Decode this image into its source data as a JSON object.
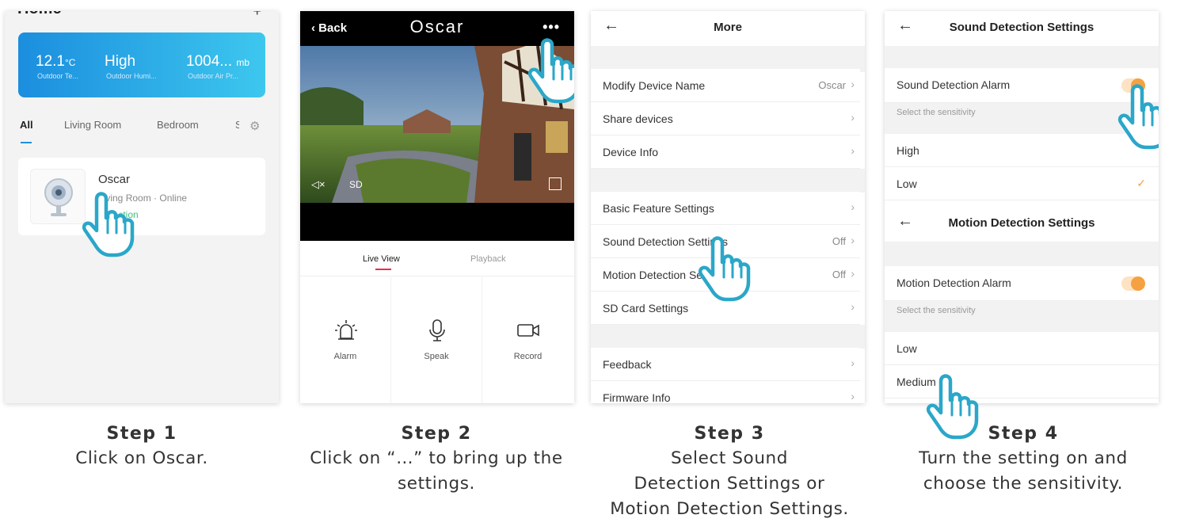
{
  "step1": {
    "home_title": "Home",
    "plus": "+",
    "weather": [
      {
        "value": "12.1",
        "unit": "°C",
        "label": "Outdoor Te..."
      },
      {
        "value": "High",
        "unit": "",
        "label": "Outdoor Humi..."
      },
      {
        "value": "1004...",
        "unit": "mb",
        "label": "Outdoor Air Pr..."
      }
    ],
    "tabs": [
      "All",
      "Living Room",
      "Bedroom",
      "S"
    ],
    "device": {
      "name": "Oscar",
      "room": "Living Room",
      "status": "Online",
      "tag": "Detection"
    },
    "caption_step": "Step 1",
    "caption_lines": [
      "Click on Oscar."
    ]
  },
  "step2": {
    "back_label": "Back",
    "title": "Oscar",
    "dots": "•••",
    "sd_label": "SD",
    "tab_live": "Live View",
    "tab_playback": "Playback",
    "actions": [
      "Alarm",
      "Speak",
      "Record"
    ],
    "caption_step": "Step 2",
    "caption_lines": [
      "Click on “…” to bring up the",
      "settings."
    ]
  },
  "step3": {
    "title": "More",
    "rows": [
      {
        "label": "Modify Device Name",
        "value": "Oscar"
      },
      {
        "label": "Share devices",
        "value": ""
      },
      {
        "label": "Device Info",
        "value": ""
      },
      {
        "label": "Basic Feature Settings",
        "value": ""
      },
      {
        "label": "Sound Detection Settings",
        "value": "Off"
      },
      {
        "label": "Motion Detection Settings",
        "value": "Off"
      },
      {
        "label": "SD Card Settings",
        "value": ""
      },
      {
        "label": "Feedback",
        "value": ""
      },
      {
        "label": "Firmware Info",
        "value": ""
      }
    ],
    "caption_step": "Step 3",
    "caption_lines": [
      "Select Sound",
      "Detection Settings or",
      "Motion Detection Settings."
    ]
  },
  "step4": {
    "sound_title": "Sound Detection Settings",
    "sound_alarm": "Sound Detection Alarm",
    "sensitivity": "Select the sensitivity",
    "sound_options": [
      "High",
      "Low"
    ],
    "motion_title": "Motion Detection Settings",
    "motion_alarm": "Motion Detection Alarm",
    "motion_options": [
      "Low",
      "Medium"
    ],
    "caption_step": "Step 4",
    "caption_lines": [
      "Turn the setting on and",
      "choose the sensitivity."
    ]
  },
  "colors": {
    "accent_orange": "#f5a142",
    "weather_blue": "#1e90e0",
    "live_red": "#e0314a",
    "hand_blue": "#2aa7c9"
  }
}
